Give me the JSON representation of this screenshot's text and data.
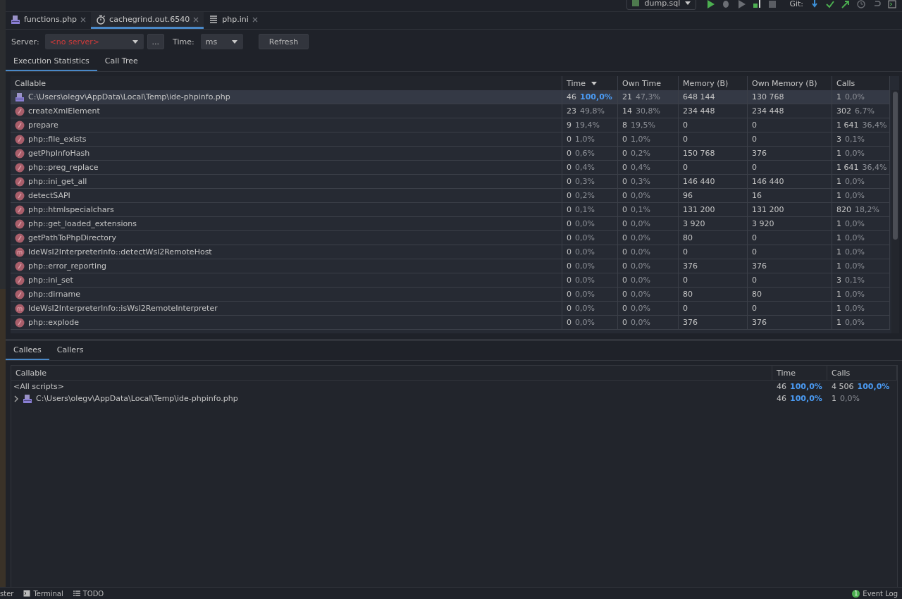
{
  "toolbar": {
    "run_config": "dump.sql",
    "git_label": "Git:"
  },
  "editor_tabs": [
    {
      "label": "functions.php",
      "kind": "php",
      "selected": false
    },
    {
      "label": "cachegrind.out.6540",
      "kind": "profile",
      "selected": true
    },
    {
      "label": "php.ini",
      "kind": "ini",
      "selected": false
    }
  ],
  "controls": {
    "server_label": "Server:",
    "server_value": "<no server>",
    "more_button": "...",
    "time_label": "Time:",
    "time_value": "ms",
    "refresh_button": "Refresh"
  },
  "view_tabs": [
    {
      "label": "Execution Statistics",
      "selected": true
    },
    {
      "label": "Call Tree",
      "selected": false
    }
  ],
  "stats": {
    "columns": [
      {
        "label": "Callable",
        "sorted": false
      },
      {
        "label": "Time",
        "sorted": true
      },
      {
        "label": "Own Time",
        "sorted": false
      },
      {
        "label": "Memory (B)",
        "sorted": false
      },
      {
        "label": "Own Memory (B)",
        "sorted": false
      },
      {
        "label": "Calls",
        "sorted": false
      }
    ],
    "rows": [
      {
        "kind": "file",
        "selected": true,
        "callable": "C:\\Users\\olegv\\AppData\\Local\\Temp\\ide-phpinfo.php",
        "time": {
          "value": "46",
          "pct": "100,0%",
          "emphasis": true
        },
        "own_time": {
          "value": "21",
          "pct": "47,3%",
          "emphasis": false
        },
        "memory": "648 144",
        "own_memory": "130 768",
        "calls": {
          "value": "1",
          "pct": "0,0%",
          "emphasis": false
        }
      },
      {
        "kind": "function",
        "selected": false,
        "callable": "createXmlElement",
        "time": {
          "value": "23",
          "pct": "49,8%",
          "emphasis": false
        },
        "own_time": {
          "value": "14",
          "pct": "30,8%",
          "emphasis": false
        },
        "memory": "234 448",
        "own_memory": "234 448",
        "calls": {
          "value": "302",
          "pct": "6,7%",
          "emphasis": false
        }
      },
      {
        "kind": "function",
        "selected": false,
        "callable": "prepare",
        "time": {
          "value": "9",
          "pct": "19,4%",
          "emphasis": false
        },
        "own_time": {
          "value": "8",
          "pct": "19,5%",
          "emphasis": false
        },
        "memory": "0",
        "own_memory": "0",
        "calls": {
          "value": "1 641",
          "pct": "36,4%",
          "emphasis": false
        }
      },
      {
        "kind": "function",
        "selected": false,
        "callable": "php::file_exists",
        "time": {
          "value": "0",
          "pct": "1,0%",
          "emphasis": false
        },
        "own_time": {
          "value": "0",
          "pct": "1,0%",
          "emphasis": false
        },
        "memory": "0",
        "own_memory": "0",
        "calls": {
          "value": "3",
          "pct": "0,1%",
          "emphasis": false
        }
      },
      {
        "kind": "function",
        "selected": false,
        "callable": "getPhpInfoHash",
        "time": {
          "value": "0",
          "pct": "0,6%",
          "emphasis": false
        },
        "own_time": {
          "value": "0",
          "pct": "0,2%",
          "emphasis": false
        },
        "memory": "150 768",
        "own_memory": "376",
        "calls": {
          "value": "1",
          "pct": "0,0%",
          "emphasis": false
        }
      },
      {
        "kind": "function",
        "selected": false,
        "callable": "php::preg_replace",
        "time": {
          "value": "0",
          "pct": "0,4%",
          "emphasis": false
        },
        "own_time": {
          "value": "0",
          "pct": "0,4%",
          "emphasis": false
        },
        "memory": "0",
        "own_memory": "0",
        "calls": {
          "value": "1 641",
          "pct": "36,4%",
          "emphasis": false
        }
      },
      {
        "kind": "function",
        "selected": false,
        "callable": "php::ini_get_all",
        "time": {
          "value": "0",
          "pct": "0,3%",
          "emphasis": false
        },
        "own_time": {
          "value": "0",
          "pct": "0,3%",
          "emphasis": false
        },
        "memory": "146 440",
        "own_memory": "146 440",
        "calls": {
          "value": "1",
          "pct": "0,0%",
          "emphasis": false
        }
      },
      {
        "kind": "function",
        "selected": false,
        "callable": "detectSAPI",
        "time": {
          "value": "0",
          "pct": "0,2%",
          "emphasis": false
        },
        "own_time": {
          "value": "0",
          "pct": "0,0%",
          "emphasis": false
        },
        "memory": "96",
        "own_memory": "16",
        "calls": {
          "value": "1",
          "pct": "0,0%",
          "emphasis": false
        }
      },
      {
        "kind": "function",
        "selected": false,
        "callable": "php::htmlspecialchars",
        "time": {
          "value": "0",
          "pct": "0,1%",
          "emphasis": false
        },
        "own_time": {
          "value": "0",
          "pct": "0,1%",
          "emphasis": false
        },
        "memory": "131 200",
        "own_memory": "131 200",
        "calls": {
          "value": "820",
          "pct": "18,2%",
          "emphasis": false
        }
      },
      {
        "kind": "function",
        "selected": false,
        "callable": "php::get_loaded_extensions",
        "time": {
          "value": "0",
          "pct": "0,0%",
          "emphasis": false
        },
        "own_time": {
          "value": "0",
          "pct": "0,0%",
          "emphasis": false
        },
        "memory": "3 920",
        "own_memory": "3 920",
        "calls": {
          "value": "1",
          "pct": "0,0%",
          "emphasis": false
        }
      },
      {
        "kind": "function",
        "selected": false,
        "callable": "getPathToPhpDirectory",
        "time": {
          "value": "0",
          "pct": "0,0%",
          "emphasis": false
        },
        "own_time": {
          "value": "0",
          "pct": "0,0%",
          "emphasis": false
        },
        "memory": "80",
        "own_memory": "0",
        "calls": {
          "value": "1",
          "pct": "0,0%",
          "emphasis": false
        }
      },
      {
        "kind": "method",
        "selected": false,
        "callable": "IdeWsl2InterpreterInfo::detectWsl2RemoteHost",
        "time": {
          "value": "0",
          "pct": "0,0%",
          "emphasis": false
        },
        "own_time": {
          "value": "0",
          "pct": "0,0%",
          "emphasis": false
        },
        "memory": "0",
        "own_memory": "0",
        "calls": {
          "value": "1",
          "pct": "0,0%",
          "emphasis": false
        }
      },
      {
        "kind": "function",
        "selected": false,
        "callable": "php::error_reporting",
        "time": {
          "value": "0",
          "pct": "0,0%",
          "emphasis": false
        },
        "own_time": {
          "value": "0",
          "pct": "0,0%",
          "emphasis": false
        },
        "memory": "376",
        "own_memory": "376",
        "calls": {
          "value": "1",
          "pct": "0,0%",
          "emphasis": false
        }
      },
      {
        "kind": "function",
        "selected": false,
        "callable": "php::ini_set",
        "time": {
          "value": "0",
          "pct": "0,0%",
          "emphasis": false
        },
        "own_time": {
          "value": "0",
          "pct": "0,0%",
          "emphasis": false
        },
        "memory": "0",
        "own_memory": "0",
        "calls": {
          "value": "3",
          "pct": "0,1%",
          "emphasis": false
        }
      },
      {
        "kind": "function",
        "selected": false,
        "callable": "php::dirname",
        "time": {
          "value": "0",
          "pct": "0,0%",
          "emphasis": false
        },
        "own_time": {
          "value": "0",
          "pct": "0,0%",
          "emphasis": false
        },
        "memory": "80",
        "own_memory": "80",
        "calls": {
          "value": "1",
          "pct": "0,0%",
          "emphasis": false
        }
      },
      {
        "kind": "method",
        "selected": false,
        "callable": "IdeWsl2InterpreterInfo::isWsl2RemoteInterpreter",
        "time": {
          "value": "0",
          "pct": "0,0%",
          "emphasis": false
        },
        "own_time": {
          "value": "0",
          "pct": "0,0%",
          "emphasis": false
        },
        "memory": "0",
        "own_memory": "0",
        "calls": {
          "value": "1",
          "pct": "0,0%",
          "emphasis": false
        }
      },
      {
        "kind": "function",
        "selected": false,
        "callable": "php::explode",
        "time": {
          "value": "0",
          "pct": "0,0%",
          "emphasis": false
        },
        "own_time": {
          "value": "0",
          "pct": "0,0%",
          "emphasis": false
        },
        "memory": "376",
        "own_memory": "376",
        "calls": {
          "value": "1",
          "pct": "0,0%",
          "emphasis": false
        }
      }
    ]
  },
  "call_panel": {
    "tabs": [
      {
        "label": "Callees",
        "selected": true
      },
      {
        "label": "Callers",
        "selected": false
      }
    ],
    "columns": [
      {
        "label": "Callable"
      },
      {
        "label": "Time"
      },
      {
        "label": "Calls"
      }
    ],
    "rows": [
      {
        "kind": "group",
        "callable": "<All scripts>",
        "time": {
          "value": "46",
          "pct": "100,0%",
          "emphasis": true
        },
        "calls": {
          "value": "4 506",
          "pct": "100,0%",
          "emphasis": true
        }
      },
      {
        "kind": "file",
        "callable": "C:\\Users\\olegv\\AppData\\Local\\Temp\\ide-phpinfo.php",
        "expanded": false,
        "time": {
          "value": "46",
          "pct": "100,0%",
          "emphasis": true
        },
        "calls": {
          "value": "1",
          "pct": "0,0%",
          "emphasis": false
        }
      }
    ]
  },
  "status_bar": {
    "items": [
      {
        "kind": "text",
        "label": "ster"
      },
      {
        "kind": "terminal",
        "label": "Terminal"
      },
      {
        "kind": "todo",
        "label": "TODO"
      }
    ],
    "event_log": {
      "label": "Event Log",
      "count": "1"
    }
  }
}
